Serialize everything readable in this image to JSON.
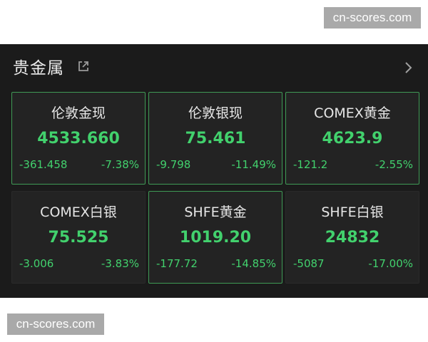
{
  "watermarks": {
    "top": "cn-scores.com",
    "bottom": "cn-scores.com"
  },
  "header": {
    "title": "贵金属",
    "share_icon": "share-external-icon",
    "chevron_icon": "chevron-right-icon"
  },
  "colors": {
    "down": "#42d16d",
    "background": "#1b1b1b",
    "card": "#232323",
    "highlight_border": "#3f9a55"
  },
  "cards": [
    {
      "name": "伦敦金现",
      "price": "4533.660",
      "change": "-361.458",
      "percent": "-7.38%",
      "highlighted": true
    },
    {
      "name": "伦敦银现",
      "price": "75.461",
      "change": "-9.798",
      "percent": "-11.49%",
      "highlighted": true
    },
    {
      "name": "COMEX黄金",
      "price": "4623.9",
      "change": "-121.2",
      "percent": "-2.55%",
      "highlighted": true
    },
    {
      "name": "COMEX白银",
      "price": "75.525",
      "change": "-3.006",
      "percent": "-3.83%",
      "highlighted": false
    },
    {
      "name": "SHFE黄金",
      "price": "1019.20",
      "change": "-177.72",
      "percent": "-14.85%",
      "highlighted": true
    },
    {
      "name": "SHFE白银",
      "price": "24832",
      "change": "-5087",
      "percent": "-17.00%",
      "highlighted": false
    }
  ]
}
